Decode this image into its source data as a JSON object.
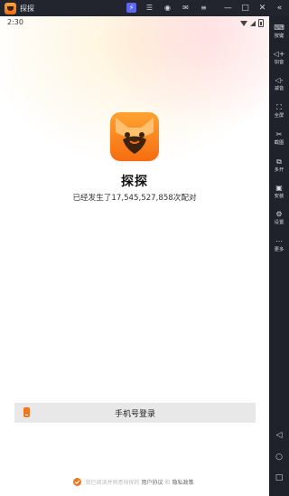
{
  "window": {
    "title": "探探",
    "controls": [
      "—",
      "□",
      "✕"
    ],
    "expand_icon": "«"
  },
  "statusbar": {
    "time": "2:30"
  },
  "app": {
    "name": "探探",
    "match_text": "已经发生了17,545,527,858次配对",
    "brand_orange": "#f56d10"
  },
  "login": {
    "phone_button_label": "手机号登录"
  },
  "agreement": {
    "prefix": "我已阅读并同意探探的",
    "user_agreement": "用户协议",
    "and": "和",
    "privacy_policy": "隐私政策"
  },
  "sidebar": {
    "items": [
      {
        "label": "按键",
        "icon": "keyboard-icon",
        "glyph": "⌨"
      },
      {
        "label": "加音",
        "icon": "volume-up-icon",
        "glyph": "◁+"
      },
      {
        "label": "减音",
        "icon": "volume-down-icon",
        "glyph": "◁-"
      },
      {
        "label": "全屏",
        "icon": "fullscreen-icon",
        "glyph": "⛶"
      },
      {
        "label": "截图",
        "icon": "scissors-icon",
        "glyph": "✂"
      },
      {
        "label": "多开",
        "icon": "multi-instance-icon",
        "glyph": "⧉"
      },
      {
        "label": "安装",
        "icon": "apk-install-icon",
        "glyph": "▣"
      },
      {
        "label": "设置",
        "icon": "settings-icon",
        "glyph": "⚙"
      },
      {
        "label": "更多",
        "icon": "more-icon",
        "glyph": "⋯"
      }
    ],
    "nav": [
      "◁",
      "○",
      "□"
    ]
  }
}
